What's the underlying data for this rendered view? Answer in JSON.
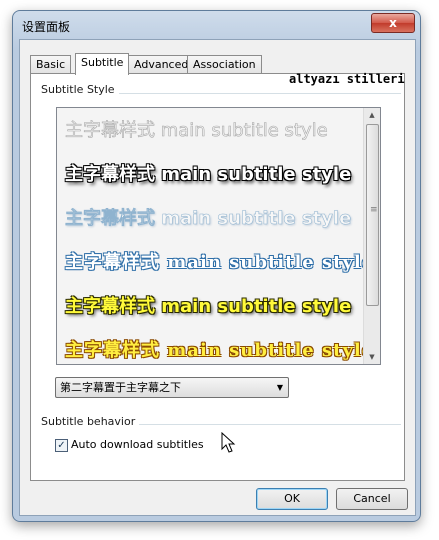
{
  "window": {
    "title": "设置面板",
    "close_label": "x"
  },
  "tabs": [
    {
      "label": "Basic",
      "active": false
    },
    {
      "label": "Subtitle",
      "active": true
    },
    {
      "label": "Advanced",
      "active": false
    },
    {
      "label": "Association",
      "active": false
    }
  ],
  "subtitle_style": {
    "group_label": "Subtitle Style",
    "preview_title": "altyazı stilleri",
    "samples": [
      "主字幕样式 main subtitle style",
      "主字幕样式 main subtitle style",
      "主字幕样式 main subtitle style",
      "主字幕样式 main subtitle style",
      "主字幕样式 main subtitle style",
      "主字幕样式 main subtitle style"
    ],
    "position_select": {
      "selected": "第二字幕置于主字幕之下"
    }
  },
  "subtitle_behavior": {
    "group_label": "Subtitle behavior",
    "auto_download": {
      "label": "Auto download subtitles",
      "checked": true
    }
  },
  "buttons": {
    "ok": "OK",
    "cancel": "Cancel"
  },
  "colors": {
    "window_frame": "#b9cbe0",
    "close_button": "#c13b2b",
    "sample_yellow": "#fffa3a",
    "sample_blue_outline": "#2f6fa8"
  }
}
